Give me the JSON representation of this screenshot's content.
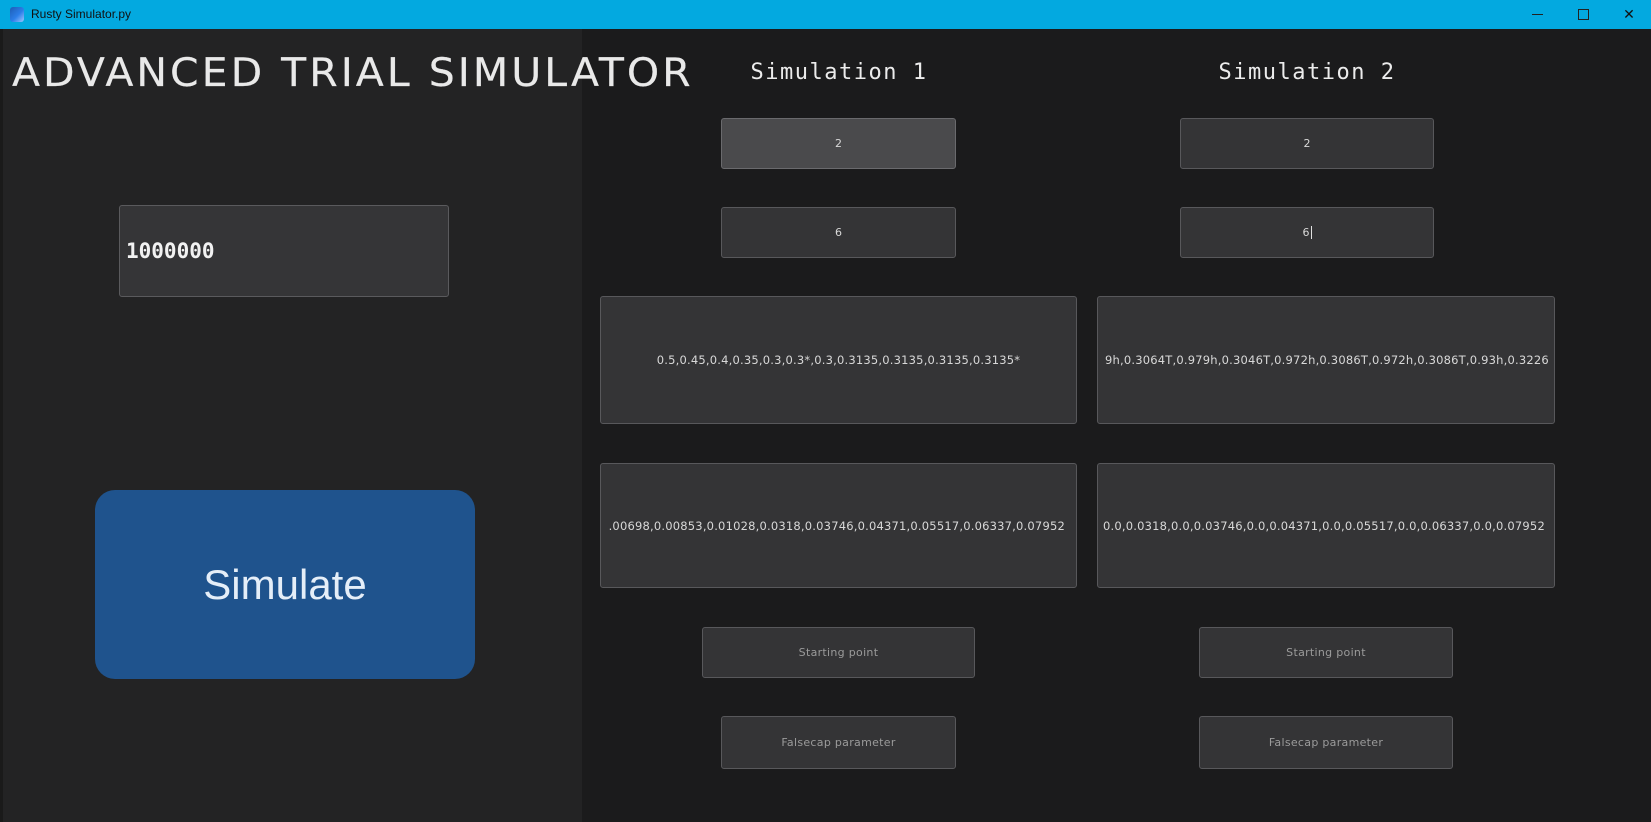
{
  "window": {
    "title": "Rusty Simulator.py",
    "controls": [
      "minimize",
      "maximize",
      "close"
    ],
    "title_bar_color": "#03a9e0"
  },
  "left": {
    "app_title": "ADVANCED TRIAL SIMULATOR",
    "trials_value": "1000000",
    "simulate_label": "Simulate",
    "simulate_color": "#1f538d"
  },
  "sim1": {
    "heading": "Simulation 1",
    "field1": "2",
    "field2": "6",
    "field3": "0.5,0.45,0.4,0.35,0.3,0.3*,0.3,0.3135,0.3135,0.3135,0.3135*",
    "field4": ".00698,0.00853,0.01028,0.0318,0.03746,0.04371,0.05517,0.06337,0.07952",
    "starting_point_placeholder": "Starting  point",
    "falsecap_placeholder": "Falsecap  parameter"
  },
  "sim2": {
    "heading": "Simulation 2",
    "field1": "2",
    "field2": "6",
    "field3": "9h,0.3064T,0.979h,0.3046T,0.972h,0.3086T,0.972h,0.3086T,0.93h,0.3226",
    "field4": "0.0,0.0318,0.0,0.03746,0.0,0.04371,0.0,0.05517,0.0,0.06337,0.0,0.07952",
    "starting_point_placeholder": "Starting  point",
    "falsecap_placeholder": "Falsecap  parameter"
  }
}
